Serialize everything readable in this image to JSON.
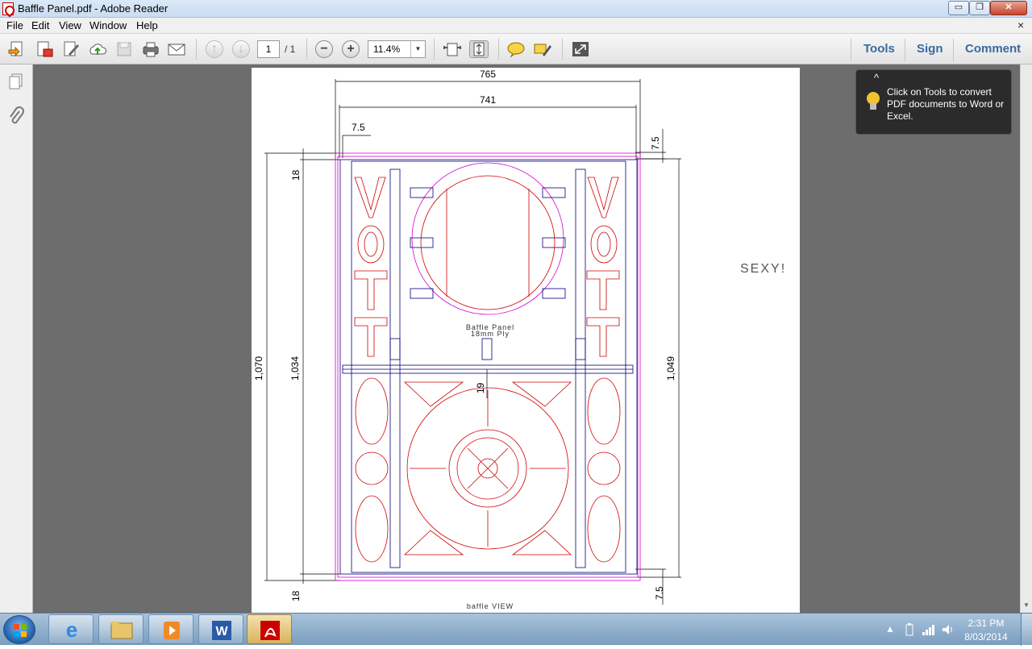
{
  "window": {
    "title": "Baffle Panel.pdf - Adobe Reader",
    "min_glyph": "▭",
    "max_glyph": "❐",
    "close_glyph": "✕"
  },
  "menu": {
    "items": [
      "File",
      "Edit",
      "View",
      "Window",
      "Help"
    ],
    "doc_close": "×"
  },
  "toolbar": {
    "page_current": "1",
    "page_total": "/ 1",
    "zoom": "11.4%",
    "zoom_minus": "−",
    "zoom_plus": "+",
    "right_tabs": [
      "Tools",
      "Sign",
      "Comment"
    ]
  },
  "tooltip": {
    "text": "Click on Tools to convert PDF documents to Word or Excel.",
    "caret": "^"
  },
  "drawing": {
    "dims": {
      "top_outer": "765",
      "top_inner": "741",
      "edge_offset": "7.5",
      "right_top": "7.5",
      "left_top": "18",
      "left_outer": "1,070",
      "left_inner": "1,034",
      "right_height": "1,049",
      "center": "19",
      "left_bottom": "18",
      "right_bottom": "7.5"
    },
    "side_text": "SEXY!",
    "label_line1": "Baffle Panel",
    "label_line2": "18mm Ply",
    "view_label": "baffle VIEW",
    "letters": [
      "V",
      "O",
      "T",
      "T"
    ],
    "colors": {
      "outline": "#00007a",
      "cut": "#d10000",
      "guide": "#d400d4"
    }
  },
  "taskbar": {
    "time": "2:31 PM",
    "date": "8/03/2014",
    "tray_arrow": "▲"
  }
}
